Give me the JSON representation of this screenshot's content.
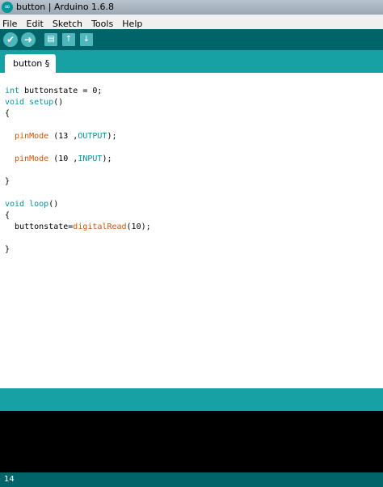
{
  "window": {
    "title": "button | Arduino 1.6.8"
  },
  "menu": {
    "items": [
      "File",
      "Edit",
      "Sketch",
      "Tools",
      "Help"
    ]
  },
  "toolbar": {
    "buttons": [
      {
        "name": "verify",
        "icon": "check-icon",
        "glyph": "✔"
      },
      {
        "name": "upload",
        "icon": "arrow-right-icon",
        "glyph": "➜"
      },
      {
        "name": "new",
        "icon": "new-file-icon",
        "glyph": "▤"
      },
      {
        "name": "open",
        "icon": "arrow-up-icon",
        "glyph": "↑"
      },
      {
        "name": "save",
        "icon": "arrow-down-icon",
        "glyph": "↓"
      }
    ]
  },
  "tab": {
    "label": "button §"
  },
  "code": {
    "l1_kw": "int",
    "l1_rest": " buttonstate = 0;",
    "l2_kw": "void",
    "l2_fn": "setup",
    "l2_rest": "()",
    "l3": "{",
    "l5_indent": "  ",
    "l5_fn": "pinMode",
    "l5_args": " (13 ,",
    "l5_const": "OUTPUT",
    "l5_end": ");",
    "l7_indent": "  ",
    "l7_fn": "pinMode",
    "l7_args": " (10 ,",
    "l7_const": "INPUT",
    "l7_end": ");",
    "l9": "}",
    "l11_kw": "void",
    "l11_fn": "loop",
    "l11_rest": "()",
    "l12": "{",
    "l13_a": "  buttonstate=",
    "l13_fn": "digitalRead",
    "l13_b": "(10);",
    "l15": "}"
  },
  "status": {
    "line_number": "14"
  },
  "colors": {
    "toolbar": "#006468",
    "tabbar": "#17a1a5",
    "keyword": "#00979c",
    "function": "#d35400"
  }
}
